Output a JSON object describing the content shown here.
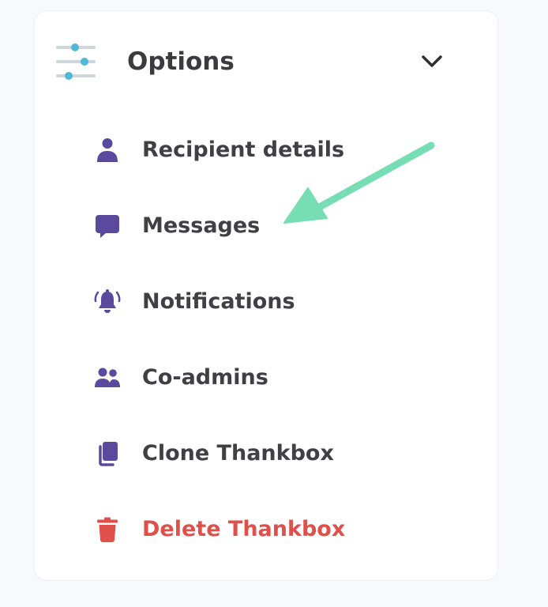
{
  "header": {
    "title": "Options",
    "icon": "sliders-icon",
    "toggle_icon": "chevron-down-icon"
  },
  "menu": {
    "items": [
      {
        "label": "Recipient details",
        "icon": "user-icon"
      },
      {
        "label": "Messages",
        "icon": "message-icon"
      },
      {
        "label": "Notifications",
        "icon": "bell-icon"
      },
      {
        "label": "Co-admins",
        "icon": "users-icon"
      },
      {
        "label": "Clone Thankbox",
        "icon": "copy-icon"
      },
      {
        "label": "Delete Thankbox",
        "icon": "trash-icon"
      }
    ]
  },
  "colors": {
    "accent": "#5a4a9e",
    "danger": "#e0504a",
    "slider_dot": "#4fb8d6",
    "annotation_arrow": "#77ddb5",
    "text": "#3f3f44"
  }
}
